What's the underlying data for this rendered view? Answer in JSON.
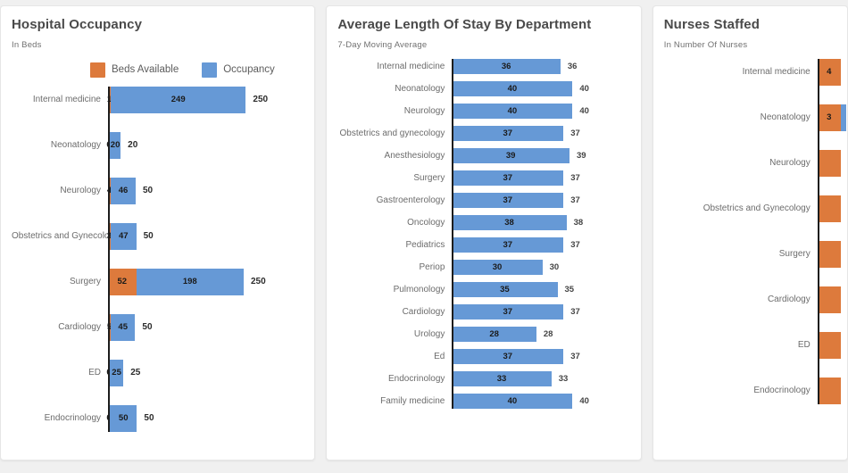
{
  "theme": {
    "orange": "#DD7A3C",
    "blue": "#6699D6",
    "page_background": "#f0f0f0",
    "card_background": "#ffffff",
    "axis_color": "#1d1d1d"
  },
  "cards": [
    {
      "title": "Hospital Occupancy",
      "subtitle": "In Beds",
      "legend": [
        {
          "label": "Beds Available",
          "color": "#DD7A3C"
        },
        {
          "label": "Occupancy",
          "color": "#6699D6"
        }
      ]
    },
    {
      "title": "Average Length Of Stay By Department",
      "subtitle": "7-Day Moving Average"
    },
    {
      "title": "Nurses Staffed",
      "subtitle": "In Number Of Nurses"
    }
  ],
  "chart_data": [
    {
      "type": "bar",
      "title": "Hospital Occupancy",
      "subtitle": "In Beds",
      "orientation": "horizontal",
      "stacked": true,
      "xlabel": "",
      "ylabel": "",
      "grid": false,
      "legend_position": "top",
      "categories": [
        "Internal medicine",
        "Neonatology",
        "Neurology",
        "Obstetrics and Gynecology",
        "Surgery",
        "Cardiology",
        "ED",
        "Endocrinology"
      ],
      "series": [
        {
          "name": "Beds Available",
          "color": "#DD7A3C",
          "values": [
            1,
            0,
            4,
            3,
            52,
            5,
            0,
            0
          ]
        },
        {
          "name": "Occupancy",
          "color": "#6699D6",
          "values": [
            249,
            20,
            46,
            47,
            198,
            45,
            25,
            50
          ]
        }
      ],
      "totals": [
        250,
        20,
        50,
        50,
        250,
        50,
        25,
        50
      ],
      "xlim": [
        0,
        250
      ]
    },
    {
      "type": "bar",
      "title": "Average Length Of Stay By Department",
      "subtitle": "7-Day Moving Average",
      "orientation": "horizontal",
      "stacked": false,
      "xlabel": "",
      "ylabel": "",
      "grid": false,
      "categories": [
        "Internal medicine",
        "Neonatology",
        "Neurology",
        "Obstetrics and gynecology",
        "Anesthesiology",
        "Surgery",
        "Gastroenterology",
        "Oncology",
        "Pediatrics",
        "Periop",
        "Pulmonology",
        "Cardiology",
        "Urology",
        "Ed",
        "Endocrinology",
        "Family medicine"
      ],
      "values": [
        36,
        40,
        40,
        37,
        39,
        37,
        37,
        38,
        37,
        30,
        35,
        37,
        28,
        37,
        33,
        40
      ],
      "color": "#6699D6",
      "xlim": [
        0,
        40
      ]
    },
    {
      "type": "bar",
      "title": "Nurses Staffed",
      "subtitle": "In Number Of Nurses",
      "orientation": "horizontal",
      "stacked": true,
      "cropped_right": true,
      "xlabel": "",
      "ylabel": "",
      "grid": false,
      "categories": [
        "Internal medicine",
        "Neonatology",
        "Neurology",
        "Obstetrics and Gynecology",
        "Surgery",
        "Cardiology",
        "ED",
        "Endocrinology"
      ],
      "series": [
        {
          "name": "Nurses Staffed",
          "color": "#DD7A3C",
          "values": [
            4,
            3,
            null,
            null,
            null,
            null,
            null,
            null
          ]
        }
      ],
      "visible_labels": [
        "4",
        "3",
        "",
        "",
        "",
        "",
        "",
        ""
      ]
    }
  ]
}
